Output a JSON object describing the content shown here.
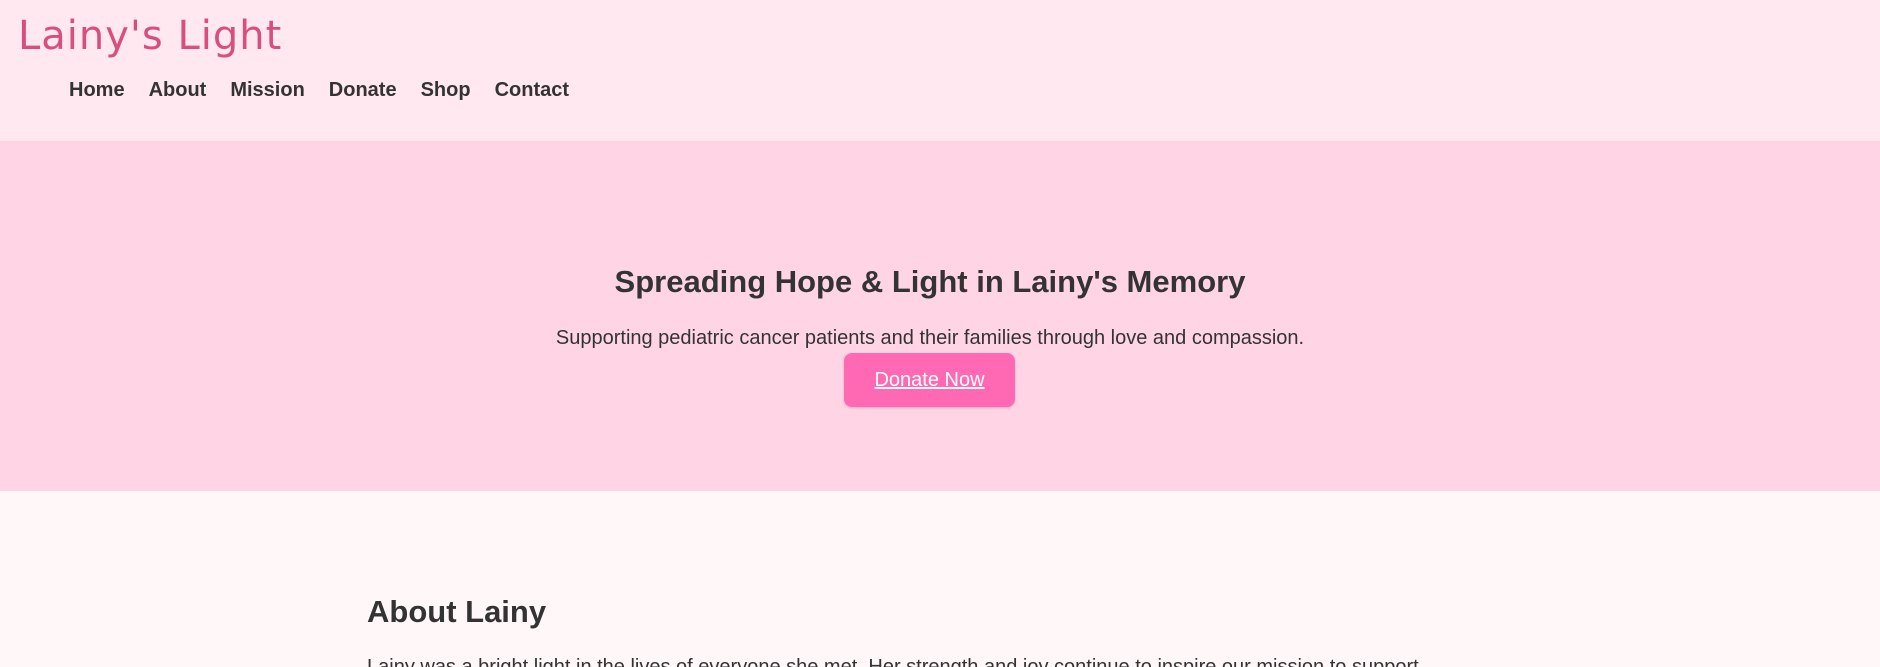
{
  "header": {
    "logo_text": "Lainy's Light",
    "nav": [
      {
        "label": "Home"
      },
      {
        "label": "About"
      },
      {
        "label": "Mission"
      },
      {
        "label": "Donate"
      },
      {
        "label": "Shop"
      },
      {
        "label": "Contact"
      }
    ]
  },
  "hero": {
    "title": "Spreading Hope & Light in Lainy's Memory",
    "subtitle": "Supporting pediatric cancer patients and their families through love and compassion.",
    "button_label": "Donate Now"
  },
  "about": {
    "title": "About Lainy",
    "text": "Lainy was a bright light in the lives of everyone she met. Her strength and joy continue to inspire our mission to support"
  },
  "colors": {
    "header_background": "#ffe8ef",
    "logo": "#d84f7c",
    "hero_background": "#ffd4e5",
    "button_background": "#ff69b4",
    "page_background": "#fff7f8",
    "text": "#333333"
  }
}
